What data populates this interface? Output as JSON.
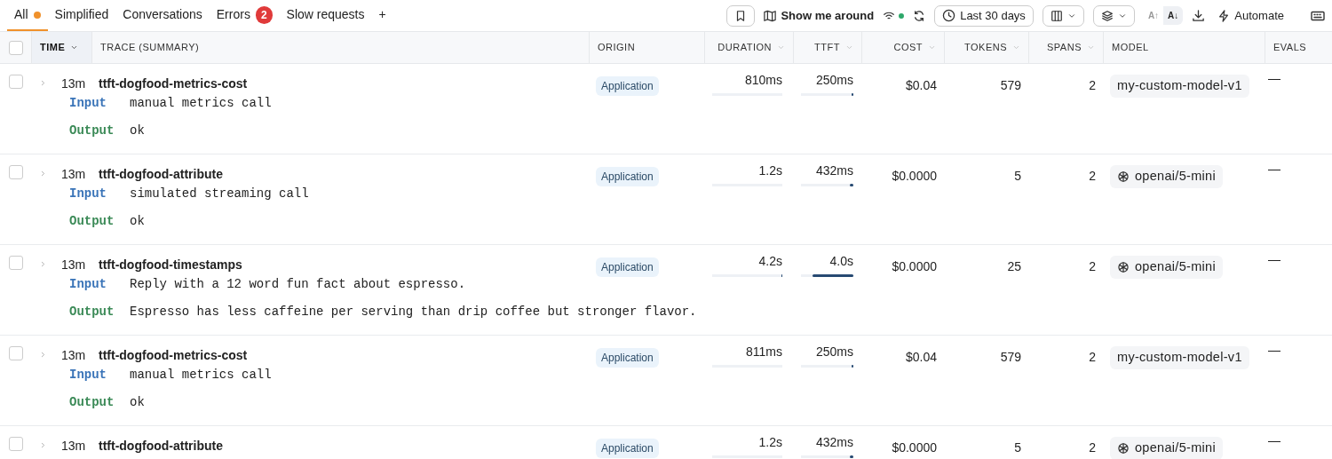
{
  "tabs": [
    {
      "label": "All",
      "selected": true,
      "color": "#f0912b"
    },
    {
      "label": "Simplified",
      "selected": false
    },
    {
      "label": "Conversations",
      "selected": false
    },
    {
      "label": "Errors",
      "selected": false,
      "count": "2"
    },
    {
      "label": "Slow requests",
      "selected": false
    }
  ],
  "add_tab": "+",
  "toolbar": {
    "tour": "Show me around",
    "live": true,
    "range": "Last 30 days",
    "sort_options": [
      {
        "label": "A↑",
        "selected": false
      },
      {
        "label": "A↓",
        "selected": true
      }
    ],
    "automate": "Automate"
  },
  "table": {
    "all_checked": false,
    "columns": [
      {
        "label": "TIME",
        "sortable": true,
        "selected": true
      },
      {
        "label": "TRACE (SUMMARY)",
        "sortable": false,
        "selected": false
      },
      {
        "label": "ORIGIN",
        "sortable": false,
        "selected": false
      },
      {
        "label": "DURATION",
        "sortable": true,
        "selected": false
      },
      {
        "label": "TTFT",
        "sortable": true,
        "selected": false
      },
      {
        "label": "COST",
        "sortable": true,
        "selected": false
      },
      {
        "label": "TOKENS",
        "sortable": true,
        "selected": false
      },
      {
        "label": "SPANS",
        "sortable": true,
        "selected": false
      },
      {
        "label": "MODEL",
        "sortable": false,
        "selected": false
      },
      {
        "label": "EVALS",
        "sortable": false,
        "selected": false
      }
    ],
    "rows": [
      {
        "checked": false,
        "time": "13m",
        "name": "ttft-dogfood-metrics-cost",
        "input_label": "Input",
        "input": "manual metrics call",
        "output_label": "Output",
        "output": "ok",
        "origin": "Application",
        "duration": {
          "text": "810ms",
          "level": 0
        },
        "ttft": {
          "text": "250ms",
          "level": 0.03
        },
        "cost": "$0.04",
        "tokens": "579",
        "spans": "2",
        "model": {
          "name": "my-custom-model-v1",
          "kind": "custom"
        },
        "evals": "—"
      },
      {
        "checked": false,
        "time": "13m",
        "name": "ttft-dogfood-attribute",
        "input_label": "Input",
        "input": "simulated streaming call",
        "output_label": "Output",
        "output": "ok",
        "origin": "Application",
        "duration": {
          "text": "1.2s",
          "level": 0
        },
        "ttft": {
          "text": "432ms",
          "level": 0.06
        },
        "cost": "$0.0000",
        "tokens": "5",
        "spans": "2",
        "model": {
          "name": "openai/5-mini",
          "kind": "openai"
        },
        "evals": "—"
      },
      {
        "checked": false,
        "time": "13m",
        "name": "ttft-dogfood-timestamps",
        "input_label": "Input",
        "input": "Reply with a 12 word fun fact about espresso.",
        "output_label": "Output",
        "output": "Espresso has less caffeine per serving than drip coffee but stronger flavor.",
        "origin": "Application",
        "duration": {
          "text": "4.2s",
          "level": 0.01
        },
        "ttft": {
          "text": "4.0s",
          "level": 0.78
        },
        "cost": "$0.0000",
        "tokens": "25",
        "spans": "2",
        "model": {
          "name": "openai/5-mini",
          "kind": "openai"
        },
        "evals": "—"
      },
      {
        "checked": false,
        "time": "13m",
        "name": "ttft-dogfood-metrics-cost",
        "input_label": "Input",
        "input": "manual metrics call",
        "output_label": "Output",
        "output": "ok",
        "origin": "Application",
        "duration": {
          "text": "811ms",
          "level": 0
        },
        "ttft": {
          "text": "250ms",
          "level": 0.03
        },
        "cost": "$0.04",
        "tokens": "579",
        "spans": "2",
        "model": {
          "name": "my-custom-model-v1",
          "kind": "custom"
        },
        "evals": "—"
      },
      {
        "checked": false,
        "time": "13m",
        "name": "ttft-dogfood-attribute",
        "origin": "Application",
        "duration": {
          "text": "1.2s",
          "level": 0
        },
        "ttft": {
          "text": "432ms",
          "level": 0.06
        },
        "cost": "$0.0000",
        "tokens": "5",
        "spans": "2",
        "model": {
          "name": "openai/5-mini",
          "kind": "openai"
        },
        "evals": "—"
      }
    ]
  }
}
